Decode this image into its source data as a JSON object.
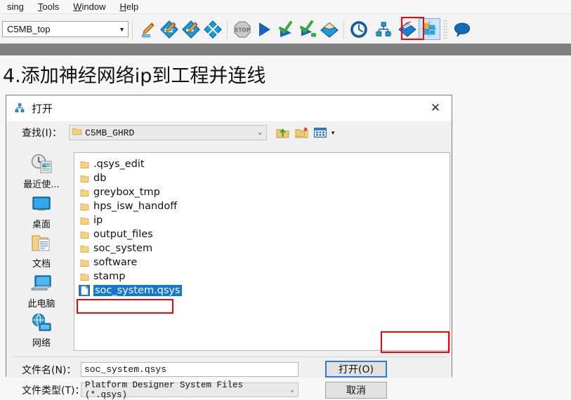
{
  "menubar": {
    "items": [
      {
        "label": "sing",
        "accel": ""
      },
      {
        "label": "Tools",
        "accel": "T"
      },
      {
        "label": "Window",
        "accel": "W"
      },
      {
        "label": "Help",
        "accel": "H"
      }
    ]
  },
  "toolbar": {
    "project_combo_value": "C5MB_top",
    "project_combo_caret": "▼",
    "icons": [
      {
        "name": "analysis-elaboration-icon"
      },
      {
        "name": "compile-design-icon"
      },
      {
        "name": "analysis-synthesis-icon"
      },
      {
        "name": "fitter-place-route-icon"
      },
      {
        "name": "stop-processing-icon",
        "label": "STOP"
      },
      {
        "name": "start-compilation-icon"
      },
      {
        "name": "assembler-icon"
      },
      {
        "name": "timing-analyzer-icon"
      },
      {
        "name": "programmer-icon"
      },
      {
        "name": "timequest-timing-icon"
      },
      {
        "name": "platform-designer-qsys-icon",
        "annotated": true
      },
      {
        "name": "signal-tap-icon"
      },
      {
        "name": "chip-planner-icon",
        "selected": true
      },
      {
        "name": "comment-bubble-icon"
      }
    ]
  },
  "heading": {
    "text": "4.添加神经网络ip到工程并连线"
  },
  "dialog": {
    "title": "打开",
    "title_icon": "platform-designer-icon",
    "close_glyph": "✕",
    "lookin": {
      "label": "查找(I)：",
      "value": "C5MB_GHRD",
      "caret": "⌄",
      "toolbar_icons": [
        {
          "name": "up-one-level-icon"
        },
        {
          "name": "create-new-folder-icon"
        },
        {
          "name": "view-menu-icon"
        }
      ],
      "view_caret": "▼"
    },
    "places": [
      {
        "name": "recent-items",
        "label": "最近使..."
      },
      {
        "name": "desktop",
        "label": "桌面"
      },
      {
        "name": "documents",
        "label": "文档"
      },
      {
        "name": "this-pc",
        "label": "此电脑"
      },
      {
        "name": "network",
        "label": "网络"
      }
    ],
    "files": [
      {
        "name": ".qsys_edit",
        "type": "folder",
        "selected": false
      },
      {
        "name": "db",
        "type": "folder",
        "selected": false
      },
      {
        "name": "greybox_tmp",
        "type": "folder",
        "selected": false
      },
      {
        "name": "hps_isw_handoff",
        "type": "folder",
        "selected": false
      },
      {
        "name": "ip",
        "type": "folder",
        "selected": false
      },
      {
        "name": "output_files",
        "type": "folder",
        "selected": false
      },
      {
        "name": "soc_system",
        "type": "folder",
        "selected": false
      },
      {
        "name": "software",
        "type": "folder",
        "selected": false
      },
      {
        "name": "stamp",
        "type": "folder",
        "selected": false
      },
      {
        "name": "soc_system.qsys",
        "type": "file",
        "selected": true
      }
    ],
    "filename": {
      "label": "文件名(N)：",
      "value": "soc_system.qsys"
    },
    "filetype": {
      "label": "文件类型(T)：",
      "value": "Platform Designer System Files (*.qsys)",
      "caret": "⌄"
    },
    "buttons": {
      "open": "打开(O)",
      "cancel": "取消"
    }
  },
  "colors": {
    "annotation_red": "#ff0000",
    "selection_blue": "#1477d1",
    "focus_blue": "#2b7bd6",
    "gray_band": "#808080",
    "page_bg": "#f7f7f7"
  }
}
